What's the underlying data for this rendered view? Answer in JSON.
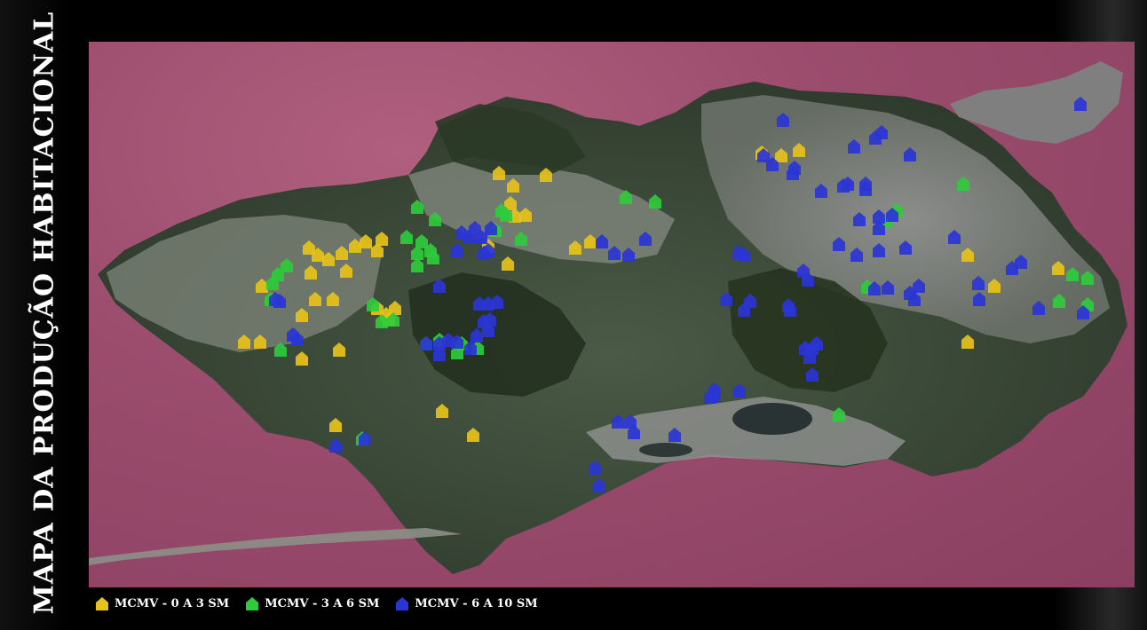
{
  "title": "MAPA DA PRODUÇÃO HABITACIONAL",
  "colors": {
    "water": "#9c4d6e",
    "land_dark": "#3b4a37",
    "land_urban": "#8e8e8e",
    "faixa1": "#e7c21a",
    "faixa2": "#2fcb3c",
    "faixa3": "#2a35d6"
  },
  "legend": [
    {
      "label": "MCMV - 0 A 3 SM",
      "color": "#e7c21a",
      "icon": "house-marker-icon"
    },
    {
      "label": "MCMV - 3 A 6 SM",
      "color": "#2fcb3c",
      "icon": "house-marker-icon"
    },
    {
      "label": "MCMV - 6 A 10 SM",
      "color": "#2a35d6",
      "icon": "house-marker-icon"
    }
  ]
}
